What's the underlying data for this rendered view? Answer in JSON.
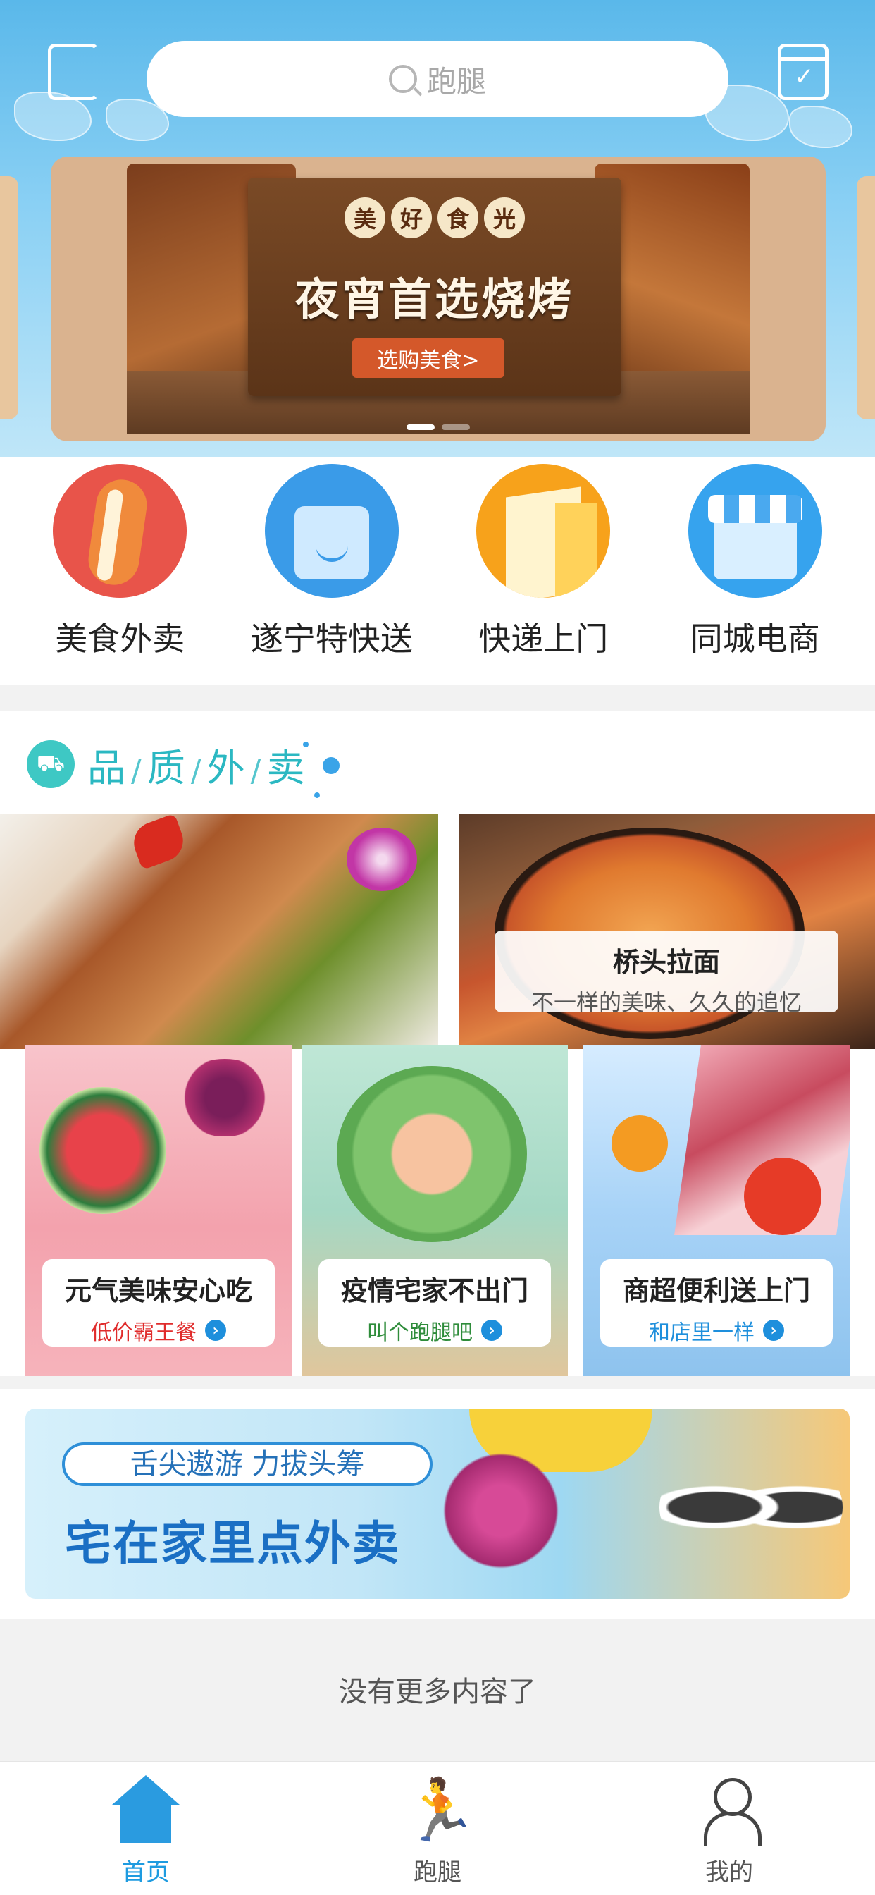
{
  "header": {
    "search_placeholder": "跑腿"
  },
  "banner": {
    "brand_chars": [
      "美",
      "好",
      "食",
      "光"
    ],
    "headline": "夜宵首选烧烤",
    "cta": "选购美食>"
  },
  "categories": [
    {
      "label": "美食外卖",
      "icon": "hotdog-icon"
    },
    {
      "label": "遂宁特快送",
      "icon": "shopping-bag-icon"
    },
    {
      "label": "快递上门",
      "icon": "milk-carton-icon"
    },
    {
      "label": "同城电商",
      "icon": "storefront-icon"
    }
  ],
  "quality": {
    "title_chars": [
      "品",
      "质",
      "外",
      "卖"
    ],
    "featured": {
      "name": "桥头拉面",
      "tagline": "不一样的美味、久久的追忆"
    },
    "cards": [
      {
        "title": "元气美味安心吃",
        "subtitle": "低价霸王餐",
        "accent": "#e02c2c"
      },
      {
        "title": "疫情宅家不出门",
        "subtitle": "叫个跑腿吧",
        "accent": "#2e8c3a"
      },
      {
        "title": "商超便利送上门",
        "subtitle": "和店里一样",
        "accent": "#1e8fdc"
      }
    ]
  },
  "promo": {
    "pill": "舌尖遨游 力拔头筹",
    "headline": "宅在家里点外卖"
  },
  "end_message": "没有更多内容了",
  "tabbar": {
    "items": [
      {
        "label": "首页",
        "icon": "home-icon",
        "active": true
      },
      {
        "label": "跑腿",
        "icon": "runner-icon",
        "active": false
      },
      {
        "label": "我的",
        "icon": "profile-icon",
        "active": false
      }
    ]
  },
  "colors": {
    "accent": "#1e9be0",
    "quality_title": "#2bb8c2"
  }
}
